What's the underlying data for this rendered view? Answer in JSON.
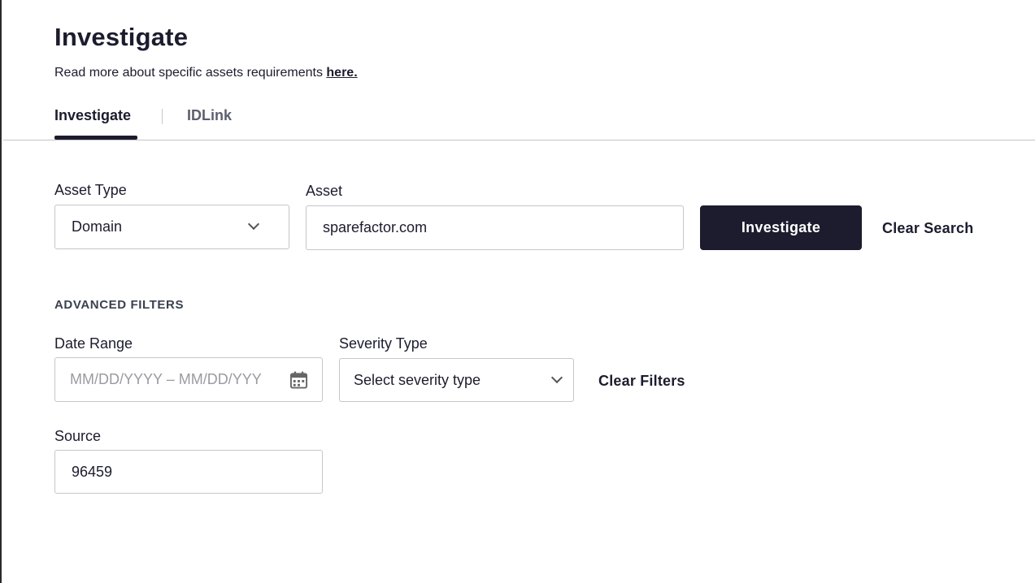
{
  "page": {
    "title": "Investigate",
    "subtitle_text": "Read more about specific assets requirements ",
    "subtitle_link": "here."
  },
  "tabs": [
    {
      "label": "Investigate",
      "active": true
    },
    {
      "label": "IDLink",
      "active": false
    }
  ],
  "search": {
    "asset_type_label": "Asset Type",
    "asset_type_value": "Domain",
    "asset_label": "Asset",
    "asset_value": "sparefactor.com",
    "investigate_button": "Investigate",
    "clear_search": "Clear Search"
  },
  "filters": {
    "heading": "ADVANCED FILTERS",
    "date_range_label": "Date Range",
    "date_range_placeholder": "MM/DD/YYYY – MM/DD/YYY",
    "severity_label": "Severity Type",
    "severity_placeholder": "Select severity type",
    "clear_filters": "Clear Filters",
    "source_label": "Source",
    "source_value": "96459"
  },
  "icons": {
    "dropdown": "chevron-down-icon",
    "calendar": "calendar-icon"
  },
  "colors": {
    "primary": "#1c1c2e",
    "border": "#c6c6cc",
    "muted_text": "#5c5f6e"
  }
}
